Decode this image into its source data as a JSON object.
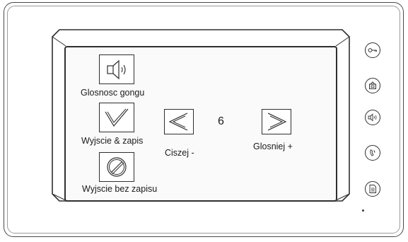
{
  "menu": {
    "gong_volume_label": "Glosnosc gongu",
    "exit_save_label": "Wyjscie & zapis",
    "exit_no_save_label": "Wyjscie bez zapisu",
    "quieter_label": "Ciszej -",
    "louder_label": "Glosniej +",
    "volume_value": "6"
  },
  "side_buttons": [
    {
      "name": "key-icon"
    },
    {
      "name": "monitor-icon"
    },
    {
      "name": "speaker-icon"
    },
    {
      "name": "handset-icon"
    },
    {
      "name": "memo-icon"
    }
  ],
  "colors": {
    "stroke": "#2f2f2f",
    "body": "#ffffff"
  }
}
